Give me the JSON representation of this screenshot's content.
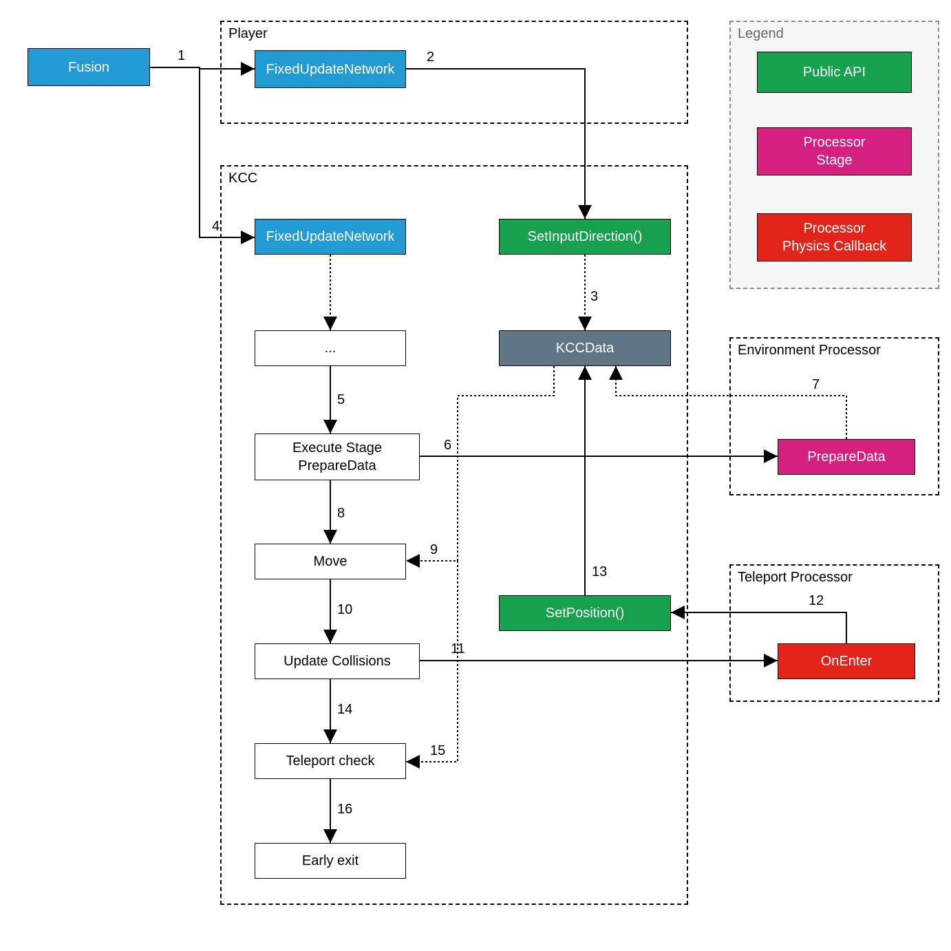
{
  "nodes": {
    "fusion": "Fusion",
    "player_fun": "FixedUpdateNetwork",
    "kcc_fun": "FixedUpdateNetwork",
    "set_input": "SetInputDirection()",
    "kccdata": "KCCData",
    "ellipsis": "...",
    "exec_stage": "Execute Stage\nPrepareData",
    "move": "Move",
    "update_coll": "Update Collisions",
    "teleport_check": "Teleport check",
    "early_exit": "Early exit",
    "prepare_data": "PrepareData",
    "set_position": "SetPosition()",
    "on_enter": "OnEnter"
  },
  "groups": {
    "player": "Player",
    "kcc": "KCC",
    "env": "Environment Processor",
    "tele": "Teleport Processor",
    "legend": "Legend"
  },
  "legend_items": {
    "api": "Public API",
    "stage": "Processor\nStage",
    "cb": "Processor\nPhysics Callback"
  },
  "edge_labels": {
    "e1": "1",
    "e2": "2",
    "e3": "3",
    "e4": "4",
    "e5": "5",
    "e6": "6",
    "e7": "7",
    "e8": "8",
    "e9": "9",
    "e10": "10",
    "e11": "11",
    "e12": "12",
    "e13": "13",
    "e14": "14",
    "e15": "15",
    "e16": "16"
  }
}
